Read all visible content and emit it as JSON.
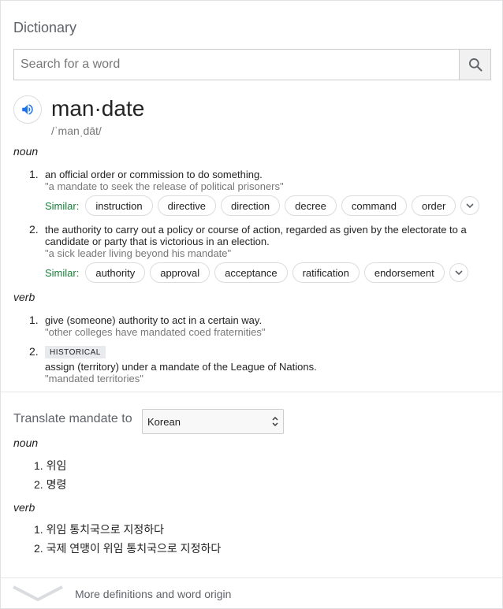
{
  "header": {
    "title": "Dictionary"
  },
  "search": {
    "placeholder": "Search for a word"
  },
  "entry": {
    "word": "man·date",
    "phonetic": "/ˈmanˌdāt/"
  },
  "noun": {
    "label": "noun",
    "senses": [
      {
        "num": "1.",
        "definition": "an official order or commission to do something.",
        "example": "\"a mandate to seek the release of political prisoners\"",
        "similar_label": "Similar:",
        "similar": [
          "instruction",
          "directive",
          "direction",
          "decree",
          "command",
          "order"
        ]
      },
      {
        "num": "2.",
        "definition": "the authority to carry out a policy or course of action, regarded as given by the electorate to a candidate or party that is victorious in an election.",
        "example": "\"a sick leader living beyond his mandate\"",
        "similar_label": "Similar:",
        "similar": [
          "authority",
          "approval",
          "acceptance",
          "ratification",
          "endorsement"
        ]
      }
    ]
  },
  "verb": {
    "label": "verb",
    "senses": [
      {
        "num": "1.",
        "definition": "give (someone) authority to act in a certain way.",
        "example": "\"other colleges have mandated coed fraternities\""
      },
      {
        "num": "2.",
        "badge": "HISTORICAL",
        "definition": "assign (territory) under a mandate of the League of Nations.",
        "example": "\"mandated territories\""
      }
    ]
  },
  "translate": {
    "label": "Translate mandate to",
    "language": "Korean",
    "noun_label": "noun",
    "noun_items": [
      "1. 위임",
      "2. 명령"
    ],
    "verb_label": "verb",
    "verb_items": [
      "1. 위임 통치국으로 지정하다",
      "2. 국제 연맹이 위임 통치국으로 지정하다"
    ]
  },
  "footer": {
    "more_label": "More definitions and word origin"
  },
  "colors": {
    "similar_green": "#188038",
    "speaker_blue": "#1a73e8",
    "muted": "#777777"
  }
}
